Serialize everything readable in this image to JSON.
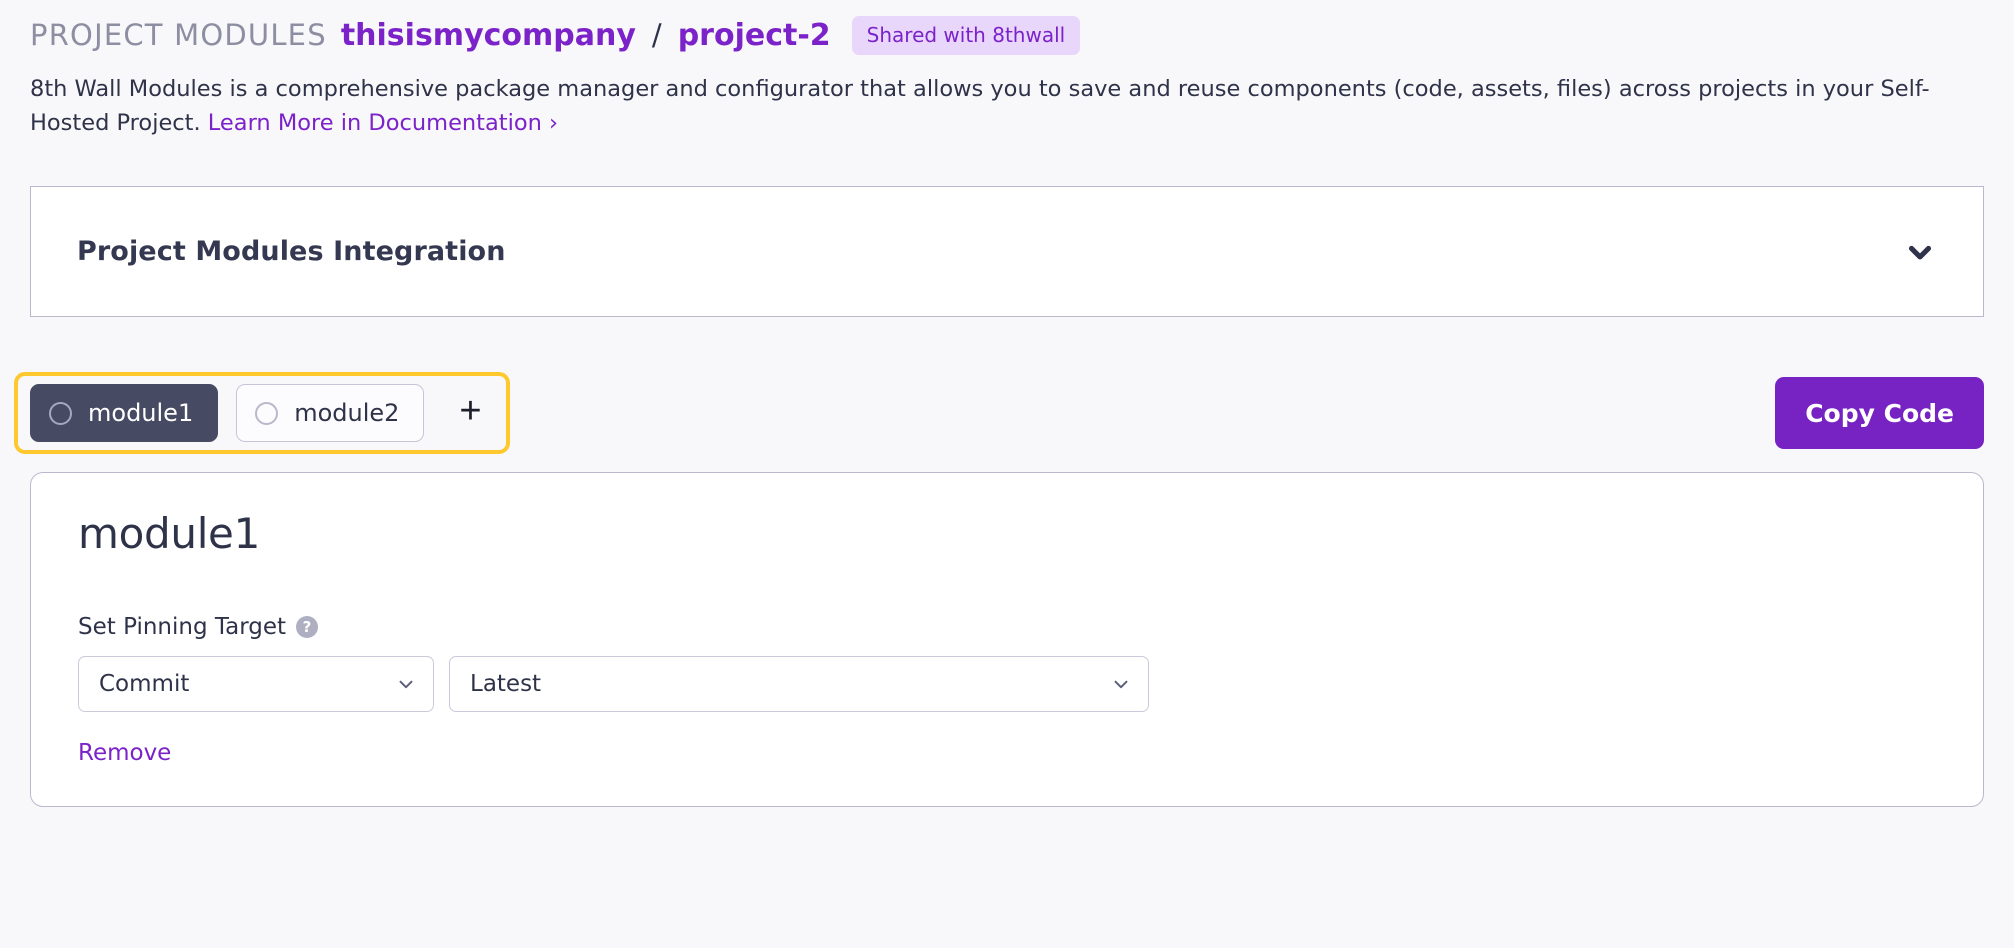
{
  "breadcrumb": {
    "section": "PROJECT MODULES",
    "org": "thisismycompany",
    "separator": "/",
    "project": "project-2",
    "shared_badge": "Shared with 8thwall"
  },
  "description": {
    "text": "8th Wall Modules is a comprehensive package manager and configurator that allows you to save and reuse components (code, assets, files) across projects in your Self-Hosted Project. ",
    "link_text": "Learn More in Documentation ›"
  },
  "integration_card": {
    "title": "Project Modules Integration",
    "chevron_icon": "chevron-down-icon",
    "expanded": false
  },
  "tabs": {
    "items": [
      {
        "label": "module1",
        "active": true,
        "radio_icon": "radio-circle-icon"
      },
      {
        "label": "module2",
        "active": false,
        "radio_icon": "radio-circle-icon"
      }
    ],
    "add_label": "+",
    "add_icon": "plus-icon",
    "highlight_color": "#ffc82e"
  },
  "actions": {
    "copy_code_label": "Copy Code",
    "copy_code_color": "#7722c2"
  },
  "module_panel": {
    "name": "module1",
    "field_label": "Set Pinning Target",
    "help_icon": "question-mark-icon",
    "help_icon_glyph": "?",
    "pinning_type": {
      "value": "Commit",
      "chevron_icon": "chevron-down-icon"
    },
    "pinning_version": {
      "value": "Latest",
      "chevron_icon": "chevron-down-icon"
    },
    "remove_label": "Remove"
  },
  "colors": {
    "page_background": "#f8f8fb",
    "accent_purple": "#7b22c9",
    "dark_slate": "#474a63",
    "text_dark": "#2f3349",
    "muted": "#8e8ea3",
    "border": "#b9b9cd",
    "badge_background": "#e8d6fb"
  }
}
